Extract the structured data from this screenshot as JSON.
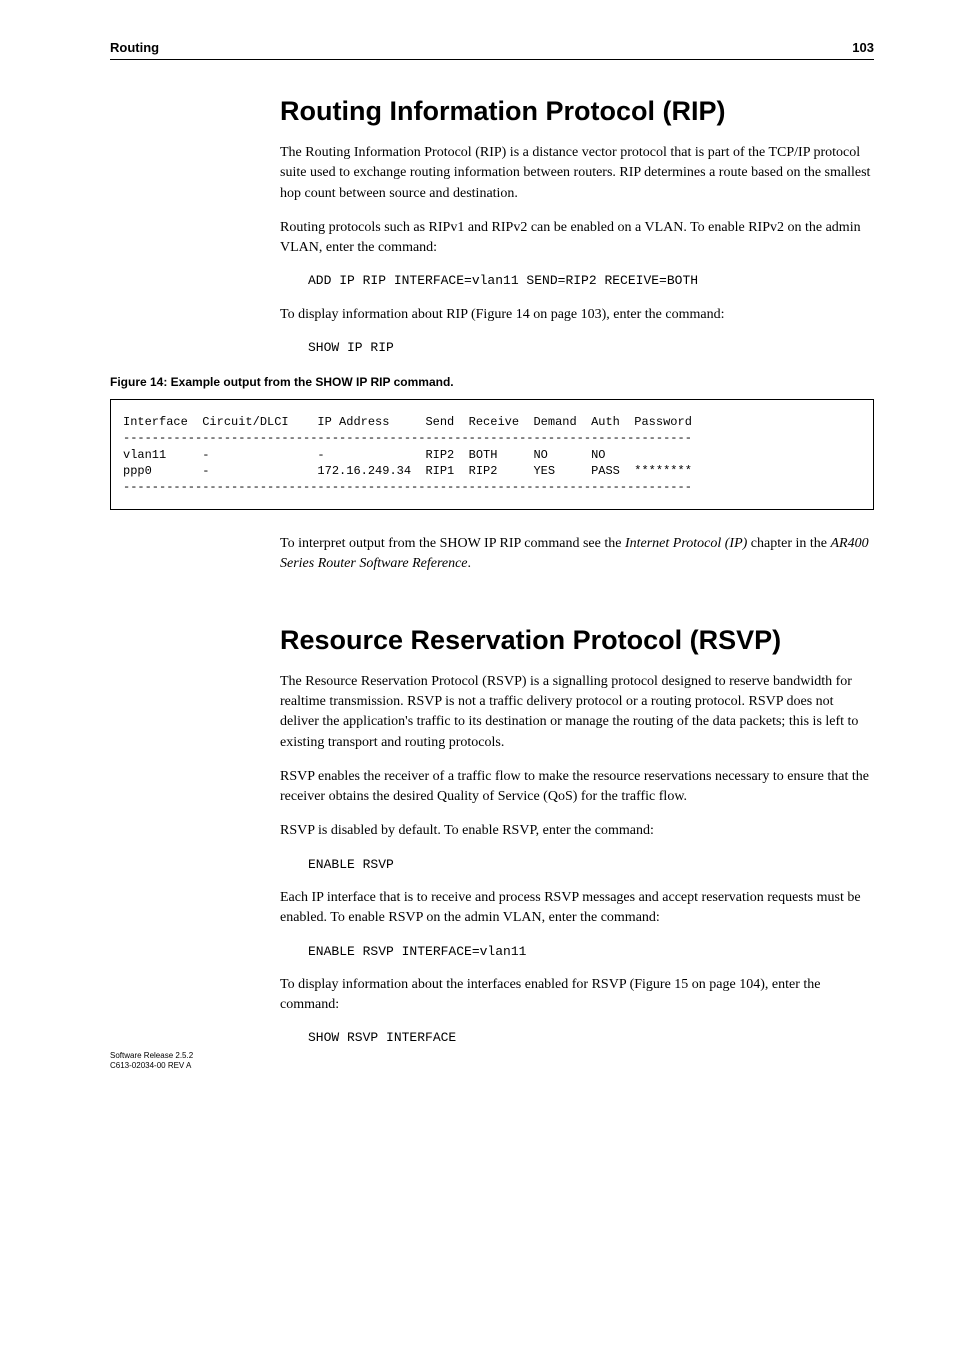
{
  "header": {
    "section": "Routing",
    "page": "103"
  },
  "section1": {
    "title": "Routing Information Protocol (RIP)",
    "p1": "The Routing Information Protocol (RIP) is a distance vector protocol that is part of the TCP/IP protocol suite used to exchange routing information between routers. RIP determines a route based on the smallest hop count between source and destination.",
    "p2": "Routing protocols such as RIPv1 and RIPv2 can be enabled on a VLAN. To enable RIPv2 on the admin VLAN, enter the command:",
    "cmd1": "ADD IP RIP INTERFACE=vlan11 SEND=RIP2 RECEIVE=BOTH",
    "p3": "To display information about RIP (Figure 14 on page 103), enter the command:",
    "cmd2": "SHOW IP RIP"
  },
  "figure14": {
    "caption": "Figure 14: Example output from the SHOW IP RIP command.",
    "output": "Interface  Circuit/DLCI    IP Address     Send  Receive  Demand  Auth  Password\n-------------------------------------------------------------------------------\nvlan11     -               -              RIP2  BOTH     NO      NO\nppp0       -               172.16.249.34  RIP1  RIP2     YES     PASS  ********\n-------------------------------------------------------------------------------"
  },
  "post_fig": {
    "p1a": "To interpret output from the SHOW IP RIP command see the ",
    "p1b": "Internet Protocol (IP)",
    "p1c": " chapter in the ",
    "p1d": "AR400 Series Router Software Reference",
    "p1e": "."
  },
  "section2": {
    "title": "Resource Reservation Protocol (RSVP)",
    "p1": "The Resource Reservation Protocol (RSVP) is a signalling protocol designed to reserve bandwidth for realtime transmission. RSVP is not a traffic delivery protocol or a routing protocol. RSVP does not deliver the application's traffic to its destination or manage the routing of the data packets; this is left to existing transport and routing protocols.",
    "p2": "RSVP enables the receiver of a traffic flow to make the resource reservations necessary to ensure that the receiver obtains the desired Quality of Service (QoS) for the traffic flow.",
    "p3": "RSVP is disabled by default. To enable RSVP, enter the command:",
    "cmd1": "ENABLE RSVP",
    "p4": "Each IP interface that is to receive and process RSVP messages and accept reservation requests must be enabled. To enable RSVP on the admin VLAN, enter the command:",
    "cmd2": "ENABLE RSVP INTERFACE=vlan11",
    "p5": "To display information about the interfaces enabled for RSVP (Figure 15 on page 104), enter the command:",
    "cmd3": "SHOW RSVP INTERFACE"
  },
  "footer": {
    "line1": "Software Release 2.5.2",
    "line2": "C613-02034-00 REV A"
  },
  "chart_data": {
    "type": "table",
    "title": "SHOW IP RIP output",
    "columns": [
      "Interface",
      "Circuit/DLCI",
      "IP Address",
      "Send",
      "Receive",
      "Demand",
      "Auth",
      "Password"
    ],
    "rows": [
      {
        "Interface": "vlan11",
        "Circuit/DLCI": "-",
        "IP Address": "-",
        "Send": "RIP2",
        "Receive": "BOTH",
        "Demand": "NO",
        "Auth": "NO",
        "Password": ""
      },
      {
        "Interface": "ppp0",
        "Circuit/DLCI": "-",
        "IP Address": "172.16.249.34",
        "Send": "RIP1",
        "Receive": "RIP2",
        "Demand": "YES",
        "Auth": "PASS",
        "Password": "********"
      }
    ]
  }
}
